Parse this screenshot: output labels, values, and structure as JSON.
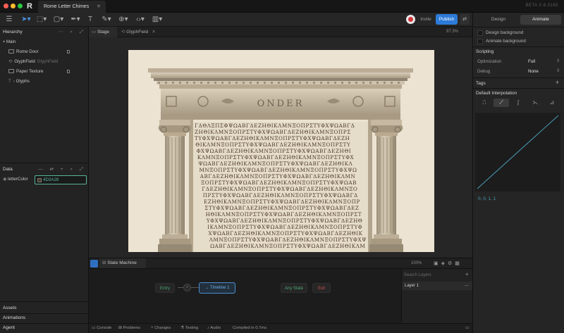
{
  "window": {
    "tab_title": "Rome Letter Chimes",
    "version": "BETA 0.8.3165"
  },
  "toolbar": {
    "invite_label": "Invite",
    "publish_label": "Publish"
  },
  "hierarchy": {
    "title": "Hierarchy",
    "items": [
      {
        "label": "Main",
        "sub": ""
      },
      {
        "label": "Rome Door",
        "sub": ""
      },
      {
        "label": "GlyphField",
        "sub": "GlyphField"
      },
      {
        "label": "Paper Texture",
        "sub": ""
      },
      {
        "label": "Glyphs",
        "sub": ""
      }
    ]
  },
  "data_panel": {
    "title": "Data",
    "field_label": "letterColor",
    "field_value": "4D3A28",
    "swatch_color": "#4D3A28"
  },
  "left_bottom": {
    "assets": "Assets",
    "animations": "Animations",
    "agent": "Agent"
  },
  "stage": {
    "tab_stage": "Stage",
    "tab_glyphfield": "GlyphField",
    "zoom": "97.3%"
  },
  "artwork": {
    "inscription": "ONDER",
    "glyph_rows": [
      "ΓΔΘΛΞΠΣΦΨΩΑΒΓΔΕΖΗΘΙΚΛΜΝΞΟΠΡΣΤΥΦΧΨΩΑΒΓΔ",
      "ΖΗΘΙΚΛΜΝΞΟΠΡΣΤΥΦΧΨΩΑΒΓΔΕΖΗΘΙΚΛΜΝΞΟΠΡΣ",
      "ΤΥΦΧΨΩΑΒΓΔΕΖΗΘΙΚΛΜΝΞΟΠΡΣΤΥΦΧΨΩΑΒΓΔΕΖΗ",
      "ΘΙΚΛΜΝΞΟΠΡΣΤΥΦΧΨΩΑΒΓΔΕΖΗΘΙΚΛΜΝΞΟΠΡΣΤΥ",
      "ΦΧΨΩΑΒΓΔΕΖΗΘΙΚΛΜΝΞΟΠΡΣΤΥΦΧΨΩΑΒΓΔΕΖΗΘΙ",
      "ΚΛΜΝΞΟΠΡΣΤΥΦΧΨΩΑΒΓΔΕΖΗΘΙΚΛΜΝΞΟΠΡΣΤΥΦΧ",
      "ΨΩΑΒΓΔΕΖΗΘΙΚΛΜΝΞΟΠΡΣΤΥΦΧΨΩΑΒΓΔΕΖΗΘΙΚΛ",
      "ΜΝΞΟΠΡΣΤΥΦΧΨΩΑΒΓΔΕΖΗΘΙΚΛΜΝΞΟΠΡΣΤΥΦΧΨΩ",
      "ΑΒΓΔΕΖΗΘΙΚΛΜΝΞΟΠΡΣΤΥΦΧΨΩΑΒΓΔΕΖΗΘΙΚΛΜΝ",
      "ΞΟΠΡΣΤΥΦΧΨΩΑΒΓΔΕΖΗΘΙΚΛΜΝΞΟΠΡΣΤΥΦΧΨΩΑΒ",
      "ΓΔΕΖΗΘΙΚΛΜΝΞΟΠΡΣΤΥΦΧΨΩΑΒΓΔΕΖΗΘΙΚΛΜΝΞΟ",
      "ΠΡΣΤΥΦΧΨΩΑΒΓΔΕΖΗΘΙΚΛΜΝΞΟΠΡΣΤΥΦΧΨΩΑΒΓΔ",
      "ΕΖΗΘΙΚΛΜΝΞΟΠΡΣΤΥΦΧΨΩΑΒΓΔΕΖΗΘΙΚΛΜΝΞΟΠΡ",
      "ΣΤΥΦΧΨΩΑΒΓΔΕΖΗΘΙΚΛΜΝΞΟΠΡΣΤΥΦΧΨΩΑΒΓΔΕΖ",
      "ΗΘΙΚΛΜΝΞΟΠΡΣΤΥΦΧΨΩΑΒΓΔΕΖΗΘΙΚΛΜΝΞΟΠΡΣΤ",
      "ΥΦΧΨΩΑΒΓΔΕΖΗΘΙΚΛΜΝΞΟΠΡΣΤΥΦΧΨΩΑΒΓΔΕΖΗΘ",
      "ΙΚΛΜΝΞΟΠΡΣΤΥΦΧΨΩΑΒΓΔΕΖΗΘΙΚΛΜΝΞΟΠΡΣΤΥΦ",
      "ΧΨΩΑΒΓΔΕΖΗΘΙΚΛΜΝΞΟΠΡΣΤΥΦΧΨΩΑΒΓΔΕΖΗΘΙΚ",
      "ΛΜΝΞΟΠΡΣΤΥΦΧΨΩΑΒΓΔΕΖΗΘΙΚΛΜΝΞΟΠΡΣΤΥΦΧΨ",
      "ΩΑΒΓΔΕΖΗΘΙΚΛΜΝΞΟΠΡΣΤΥΦΧΨΩΑΒΓΔΕΖΗΘΙΚΛΜ"
    ]
  },
  "state_machine": {
    "tab_label": "State Machine 1",
    "zoom": "100%",
    "nodes": {
      "entry": "Entry",
      "timeline": "Timeline 1",
      "any_state": "Any State",
      "exit": "Exit"
    },
    "search_placeholder": "Search Layers",
    "layer": "Layer 1"
  },
  "status_bar": {
    "console": "Console",
    "problems": "Problems",
    "changes": "Changes",
    "testing": "Testing",
    "audio": "Audio",
    "compiled": "Compiled in 0.7ms"
  },
  "right_panel": {
    "tab_design": "Design",
    "tab_animate": "Animate",
    "design_background": "Design background",
    "animate_background": "Animate background",
    "scripting_title": "Scripting",
    "optimization_label": "Optimization",
    "optimization_value": "Full",
    "debug_label": "Debug",
    "debug_value": "None",
    "tags_title": "Tags",
    "interp_title": "Default Interpolation",
    "curve_values": "0, 0, 1, 1"
  },
  "colors": {
    "accent": "#2D7BD8",
    "field_accent": "#57B39A",
    "curve": "#4A9FB8",
    "stone": "#C9BBA4",
    "glyph_ink": "#4D3A28"
  }
}
